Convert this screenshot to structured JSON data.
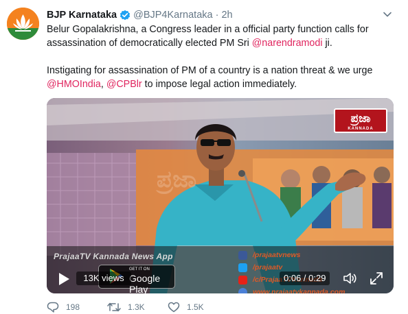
{
  "tweet": {
    "author_name": "BJP Karnataka",
    "handle": "@BJP4Karnataka",
    "separator": "·",
    "time": "2h",
    "line1_before": "Belur Gopalakrishna, a Congress leader in a official party function calls for assassination of democratically elected PM Sri ",
    "line1_mention": "@narendramodi",
    "line1_after": " ji.",
    "line2_before": "Instigating for assassination of PM of a country is a nation threat & we urge ",
    "line2_mention1": "@HMOIndia",
    "line2_comma": ", ",
    "line2_mention2": "@CPBlr",
    "line2_after": " to impose legal action immediately."
  },
  "video": {
    "channel_logo": "ಪ್ರಜಾ",
    "channel_logo_sub": "KANNADA",
    "ticker_text": "PrajaaTV Kannada News App",
    "social": [
      "/prajaatvnews",
      "/prajaatv",
      "/c/PrajaaTVKannada",
      "www.prajaatvkannada.com"
    ],
    "views": "13K views",
    "store_small": "GET IT ON",
    "store_big": "Google Play",
    "time": "0:06 / 0:29"
  },
  "actions": {
    "replies": "198",
    "retweets": "1.3K",
    "likes": "1.5K"
  },
  "colors": {
    "mention": "#e0245e",
    "verified": "#1da1f2",
    "avatar_bg": "#f4821f"
  },
  "icons": [
    "bjp-lotus-icon",
    "verified-icon",
    "chevron-down-icon",
    "play-icon",
    "volume-icon",
    "fullscreen-icon",
    "reply-icon",
    "retweet-icon",
    "like-icon"
  ]
}
